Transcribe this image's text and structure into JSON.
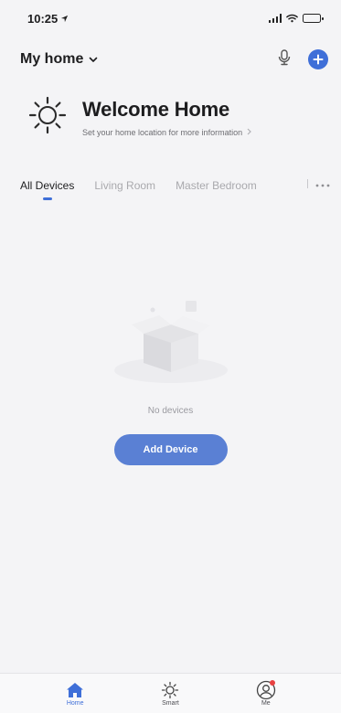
{
  "status_bar": {
    "time": "10:25",
    "icons": [
      "location-arrow-icon",
      "signal-icon",
      "wifi-icon",
      "battery-icon"
    ]
  },
  "header": {
    "home_name": "My home",
    "icons": [
      "chevron-down-icon",
      "microphone-icon",
      "add-icon"
    ],
    "accent_color": "#3f6fd8"
  },
  "welcome": {
    "title": "Welcome Home",
    "subtitle": "Set your home location for more information",
    "icons": [
      "sun-icon",
      "chevron-right-icon"
    ]
  },
  "room_tabs": {
    "tabs": [
      {
        "label": "All Devices",
        "active": true
      },
      {
        "label": "Living Room",
        "active": false
      },
      {
        "label": "Master Bedroom",
        "active": false
      }
    ],
    "icons": [
      "more-icon"
    ]
  },
  "empty_state": {
    "message": "No devices",
    "button_label": "Add Device",
    "icons": [
      "empty-box-icon"
    ],
    "button_color": "#5a80d4"
  },
  "tab_bar": {
    "items": [
      {
        "label": "Home",
        "icon": "home-icon",
        "active": true
      },
      {
        "label": "Smart",
        "icon": "smart-sun-icon",
        "active": false
      },
      {
        "label": "Me",
        "icon": "profile-icon",
        "active": false
      }
    ]
  }
}
